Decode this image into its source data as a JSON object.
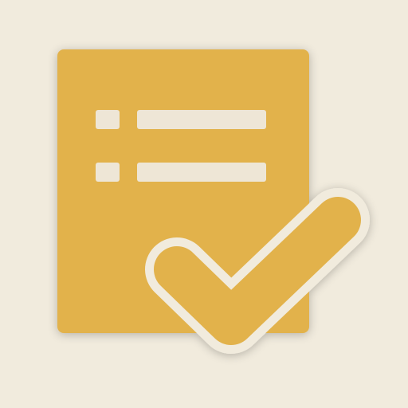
{
  "icon": {
    "name": "checklist-document-icon",
    "colors": {
      "background": "#f1ebdd",
      "document": "#e2b24c",
      "lines": "#eee6d6",
      "checkmark": "#e2b24c",
      "outline": "#f1ebdd"
    }
  }
}
